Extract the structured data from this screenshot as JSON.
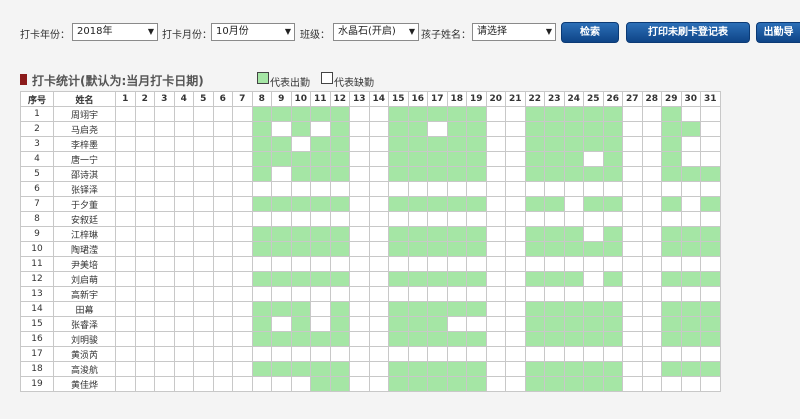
{
  "filters": {
    "year_label": "打卡年份：",
    "year_value": "2018年",
    "month_label": "打卡月份：",
    "month_value": "10月份",
    "class_label": "班级：",
    "class_value": "水晶石(开启)",
    "child_label": "孩子姓名：",
    "child_value": "请选择"
  },
  "buttons": {
    "search": "检索",
    "print": "打印未刷卡登记表",
    "export": "出勤导"
  },
  "stats": {
    "title": "打卡统计(默认为:当月打卡日期)",
    "legend_present": "代表出勤",
    "legend_absent": "代表缺勤"
  },
  "colors": {
    "present": "#a5e6a5",
    "absent": "#ffffff",
    "button": "#1a5aa3",
    "title_mark": "#8b1a1a"
  },
  "table": {
    "headers": {
      "index": "序号",
      "name": "姓名",
      "days": [
        "1",
        "2",
        "3",
        "4",
        "5",
        "6",
        "7",
        "8",
        "9",
        "10",
        "11",
        "12",
        "13",
        "14",
        "15",
        "16",
        "17",
        "18",
        "19",
        "20",
        "21",
        "22",
        "23",
        "24",
        "25",
        "26",
        "27",
        "28",
        "29",
        "30",
        "31"
      ]
    },
    "rows": [
      {
        "index": "1",
        "name": "周翊宇",
        "present": [
          8,
          9,
          10,
          11,
          12,
          15,
          16,
          17,
          18,
          19,
          22,
          23,
          24,
          25,
          26,
          29
        ]
      },
      {
        "index": "2",
        "name": "马启尧",
        "present": [
          8,
          10,
          12,
          15,
          16,
          18,
          19,
          22,
          23,
          24,
          25,
          26,
          29,
          30
        ]
      },
      {
        "index": "3",
        "name": "李梓墨",
        "present": [
          8,
          9,
          11,
          12,
          15,
          16,
          17,
          18,
          19,
          22,
          23,
          24,
          25,
          26,
          29
        ]
      },
      {
        "index": "4",
        "name": "唐一宁",
        "present": [
          8,
          9,
          10,
          11,
          12,
          15,
          16,
          17,
          18,
          19,
          22,
          23,
          24,
          26,
          29
        ]
      },
      {
        "index": "5",
        "name": "邵诗淇",
        "present": [
          8,
          10,
          11,
          12,
          15,
          16,
          17,
          18,
          19,
          22,
          23,
          24,
          25,
          26,
          29,
          30,
          31
        ]
      },
      {
        "index": "6",
        "name": "张铎泽",
        "present": []
      },
      {
        "index": "7",
        "name": "于夕董",
        "present": [
          8,
          9,
          10,
          11,
          12,
          15,
          16,
          17,
          18,
          19,
          22,
          23,
          25,
          26,
          29,
          31
        ]
      },
      {
        "index": "8",
        "name": "安叙廷",
        "present": []
      },
      {
        "index": "9",
        "name": "江梓琳",
        "present": [
          8,
          9,
          10,
          11,
          12,
          15,
          16,
          17,
          18,
          19,
          22,
          23,
          24,
          26,
          29,
          30,
          31
        ]
      },
      {
        "index": "10",
        "name": "陶珺滢",
        "present": [
          8,
          9,
          10,
          11,
          12,
          15,
          16,
          17,
          18,
          19,
          22,
          23,
          24,
          25,
          26,
          29,
          30,
          31
        ]
      },
      {
        "index": "11",
        "name": "尹美培",
        "present": []
      },
      {
        "index": "12",
        "name": "刘启萌",
        "present": [
          8,
          9,
          10,
          11,
          12,
          15,
          16,
          17,
          18,
          19,
          22,
          23,
          24,
          26,
          29,
          30,
          31
        ]
      },
      {
        "index": "13",
        "name": "高新宇",
        "present": []
      },
      {
        "index": "14",
        "name": "田幕",
        "present": [
          8,
          9,
          10,
          12,
          15,
          16,
          17,
          18,
          19,
          22,
          23,
          24,
          25,
          26,
          29,
          30,
          31
        ]
      },
      {
        "index": "15",
        "name": "张睿泽",
        "present": [
          8,
          10,
          12,
          15,
          16,
          17,
          22,
          23,
          24,
          25,
          26,
          29,
          30,
          31
        ]
      },
      {
        "index": "16",
        "name": "刘明骏",
        "present": [
          8,
          9,
          10,
          11,
          12,
          15,
          16,
          17,
          18,
          19,
          22,
          23,
          24,
          25,
          26,
          29,
          30,
          31
        ]
      },
      {
        "index": "17",
        "name": "黄涢芮",
        "present": []
      },
      {
        "index": "18",
        "name": "高浚航",
        "present": [
          8,
          9,
          10,
          11,
          12,
          15,
          16,
          17,
          18,
          19,
          22,
          23,
          24,
          25,
          26,
          29,
          30,
          31
        ]
      },
      {
        "index": "19",
        "name": "黄佳烨",
        "present": [
          11,
          12,
          15,
          16,
          17,
          18,
          19,
          22,
          23,
          24,
          25,
          26
        ]
      }
    ]
  }
}
